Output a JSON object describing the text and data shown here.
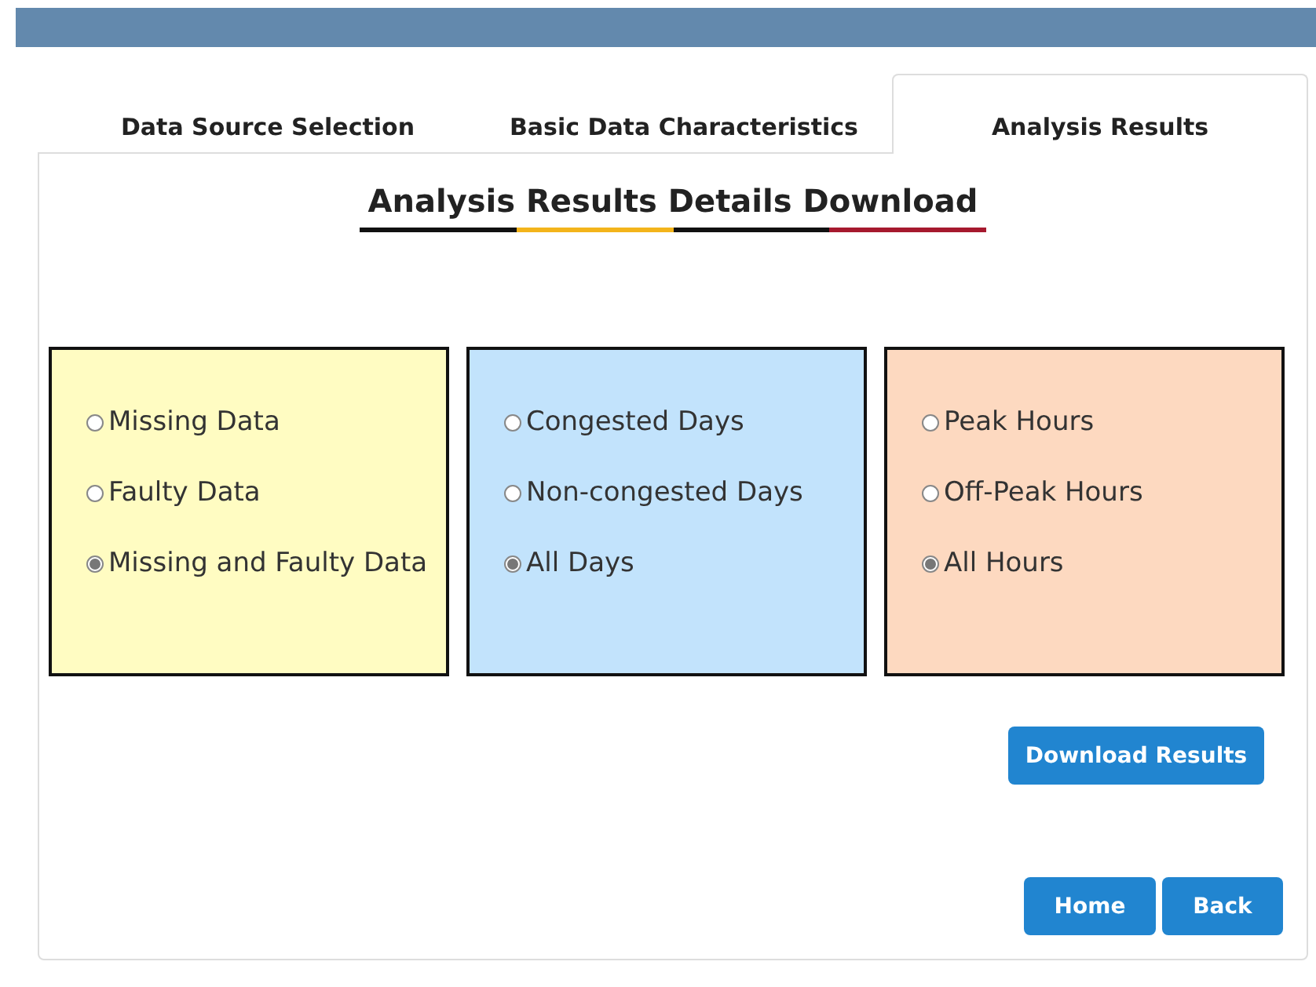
{
  "tabs": [
    {
      "label": "Data Source Selection",
      "selected": false
    },
    {
      "label": "Basic Data Characteristics",
      "selected": false
    },
    {
      "label": "Analysis Results",
      "selected": true
    }
  ],
  "heading": "Analysis Results Details Download",
  "option_groups": [
    {
      "color": "#fffcc2",
      "options": [
        {
          "label": "Missing Data",
          "selected": false
        },
        {
          "label": "Faulty Data",
          "selected": false
        },
        {
          "label": "Missing and Faulty Data",
          "selected": true
        }
      ]
    },
    {
      "color": "#c2e3fc",
      "options": [
        {
          "label": "Congested Days",
          "selected": false
        },
        {
          "label": "Non-congested Days",
          "selected": false
        },
        {
          "label": "All Days",
          "selected": true
        }
      ]
    },
    {
      "color": "#fdd9c0",
      "options": [
        {
          "label": "Peak Hours",
          "selected": false
        },
        {
          "label": "Off-Peak Hours",
          "selected": false
        },
        {
          "label": "All Hours",
          "selected": true
        }
      ]
    }
  ],
  "download_button": "Download Results",
  "nav_buttons": [
    "Home",
    "Back"
  ]
}
